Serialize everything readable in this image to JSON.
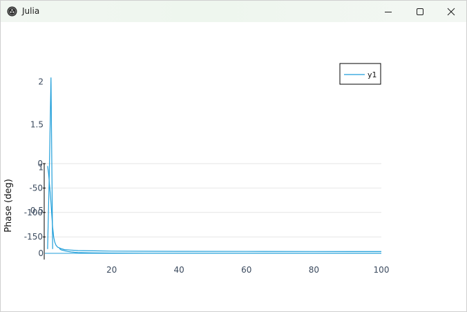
{
  "window": {
    "title": "Julia",
    "icons": {
      "app": "julia-logo-icon",
      "minimize": "minimize-icon",
      "maximize": "maximize-icon",
      "close": "close-icon"
    }
  },
  "colors": {
    "series": "#1f9ed9",
    "grid": "#e6e6e6",
    "tick_text": "#3b4a5e",
    "legend_border": "#000000"
  },
  "chart_data": [
    {
      "type": "line",
      "panel": "top",
      "yticks": [
        "2",
        "1.5",
        "1",
        "0.5",
        "0"
      ],
      "ylim": [
        0,
        2.1
      ],
      "xticks": [
        "20",
        "40",
        "60",
        "80",
        "100"
      ],
      "xlim": [
        0,
        100
      ],
      "legend": {
        "entries": [
          "y1"
        ],
        "placement": "top-right"
      },
      "grid": false,
      "series": [
        {
          "name": "y1",
          "x": [
            1,
            1.5,
            2,
            2.5
          ],
          "y": [
            0.05,
            0.9,
            2.05,
            0.05
          ]
        },
        {
          "x": [
            4.5,
            5,
            6,
            7,
            8,
            9,
            10,
            12,
            15,
            20,
            30,
            40,
            60,
            80,
            100
          ],
          "y": [
            0.055,
            0.04,
            0.03,
            0.022,
            0.016,
            0.012,
            0.01,
            0.007,
            0.005,
            0.003,
            0.002,
            0.0015,
            0.001,
            0.001,
            0.001
          ]
        }
      ]
    },
    {
      "type": "line",
      "panel": "overlay",
      "ylabel": "Phase (deg)",
      "yticks": [
        "0",
        "-50",
        "-100",
        "-150"
      ],
      "ylim": [
        -185,
        0
      ],
      "grid": true,
      "series": [
        {
          "x": [
            1,
            1.3,
            1.6,
            1.9,
            2.2,
            2.5,
            2.8,
            3.1,
            3.5,
            4,
            5,
            6,
            8,
            10,
            15,
            20,
            30,
            40,
            60,
            80,
            100
          ],
          "y": [
            -5,
            -20,
            -45,
            -70,
            -100,
            -130,
            -150,
            -160,
            -167,
            -171,
            -174,
            -176,
            -177,
            -178,
            -178.5,
            -179,
            -179.3,
            -179.5,
            -179.7,
            -179.8,
            -179.9
          ]
        }
      ]
    }
  ]
}
